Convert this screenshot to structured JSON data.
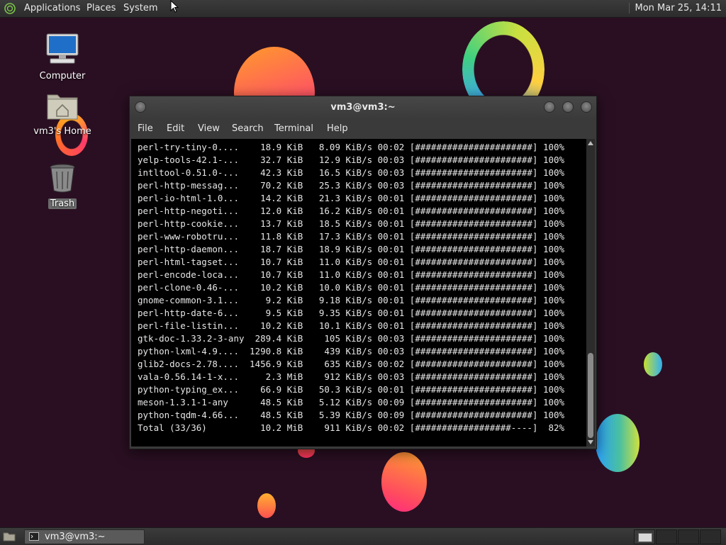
{
  "top_panel": {
    "menus": [
      "Applications",
      "Places",
      "System"
    ],
    "clock": "Mon Mar 25, 14:11"
  },
  "desktop_icons": [
    {
      "label": "Computer",
      "icon": "computer-icon"
    },
    {
      "label": "vm3's Home",
      "icon": "home-folder-icon"
    },
    {
      "label": "Trash",
      "icon": "trash-icon"
    }
  ],
  "window": {
    "title": "vm3@vm3:~",
    "menus": [
      "File",
      "Edit",
      "View",
      "Search",
      "Terminal",
      "Help"
    ]
  },
  "terminal": {
    "lines": [
      {
        "name": "perl-try-tiny-0....",
        "size": "18.9 KiB",
        "rate": "8.09 KiB/s",
        "time": "00:02",
        "bar": "[######################]",
        "pct": "100%"
      },
      {
        "name": "yelp-tools-42.1-...",
        "size": "32.7 KiB",
        "rate": "12.9 KiB/s",
        "time": "00:03",
        "bar": "[######################]",
        "pct": "100%"
      },
      {
        "name": "intltool-0.51.0-...",
        "size": "42.3 KiB",
        "rate": "16.5 KiB/s",
        "time": "00:03",
        "bar": "[######################]",
        "pct": "100%"
      },
      {
        "name": "perl-http-messag...",
        "size": "70.2 KiB",
        "rate": "25.3 KiB/s",
        "time": "00:03",
        "bar": "[######################]",
        "pct": "100%"
      },
      {
        "name": "perl-io-html-1.0...",
        "size": "14.2 KiB",
        "rate": "21.3 KiB/s",
        "time": "00:01",
        "bar": "[######################]",
        "pct": "100%"
      },
      {
        "name": "perl-http-negoti...",
        "size": "12.0 KiB",
        "rate": "16.2 KiB/s",
        "time": "00:01",
        "bar": "[######################]",
        "pct": "100%"
      },
      {
        "name": "perl-http-cookie...",
        "size": "13.7 KiB",
        "rate": "18.5 KiB/s",
        "time": "00:01",
        "bar": "[######################]",
        "pct": "100%"
      },
      {
        "name": "perl-www-robotru...",
        "size": "11.8 KiB",
        "rate": "17.3 KiB/s",
        "time": "00:01",
        "bar": "[######################]",
        "pct": "100%"
      },
      {
        "name": "perl-http-daemon...",
        "size": "18.7 KiB",
        "rate": "18.9 KiB/s",
        "time": "00:01",
        "bar": "[######################]",
        "pct": "100%"
      },
      {
        "name": "perl-html-tagset...",
        "size": "10.7 KiB",
        "rate": "11.0 KiB/s",
        "time": "00:01",
        "bar": "[######################]",
        "pct": "100%"
      },
      {
        "name": "perl-encode-loca...",
        "size": "10.7 KiB",
        "rate": "11.0 KiB/s",
        "time": "00:01",
        "bar": "[######################]",
        "pct": "100%"
      },
      {
        "name": "perl-clone-0.46-...",
        "size": "10.2 KiB",
        "rate": "10.0 KiB/s",
        "time": "00:01",
        "bar": "[######################]",
        "pct": "100%"
      },
      {
        "name": "gnome-common-3.1...",
        "size": "9.2 KiB",
        "rate": "9.18 KiB/s",
        "time": "00:01",
        "bar": "[######################]",
        "pct": "100%"
      },
      {
        "name": "perl-http-date-6...",
        "size": "9.5 KiB",
        "rate": "9.35 KiB/s",
        "time": "00:01",
        "bar": "[######################]",
        "pct": "100%"
      },
      {
        "name": "perl-file-listin...",
        "size": "10.2 KiB",
        "rate": "10.1 KiB/s",
        "time": "00:01",
        "bar": "[######################]",
        "pct": "100%"
      },
      {
        "name": "gtk-doc-1.33.2-3-any",
        "size": "289.4 KiB",
        "rate": "105 KiB/s",
        "time": "00:03",
        "bar": "[######################]",
        "pct": "100%"
      },
      {
        "name": "python-lxml-4.9....",
        "size": "1290.8 KiB",
        "rate": "439 KiB/s",
        "time": "00:03",
        "bar": "[######################]",
        "pct": "100%"
      },
      {
        "name": "glib2-docs-2.78....",
        "size": "1456.9 KiB",
        "rate": "635 KiB/s",
        "time": "00:02",
        "bar": "[######################]",
        "pct": "100%"
      },
      {
        "name": "vala-0.56.14-1-x...",
        "size": "2.3 MiB",
        "rate": "912 KiB/s",
        "time": "00:03",
        "bar": "[######################]",
        "pct": "100%"
      },
      {
        "name": "python-typing_ex...",
        "size": "66.9 KiB",
        "rate": "50.3 KiB/s",
        "time": "00:01",
        "bar": "[######################]",
        "pct": "100%"
      },
      {
        "name": "meson-1.3.1-1-any",
        "size": "48.5 KiB",
        "rate": "5.12 KiB/s",
        "time": "00:09",
        "bar": "[######################]",
        "pct": "100%"
      },
      {
        "name": "python-tqdm-4.66...",
        "size": "48.5 KiB",
        "rate": "5.39 KiB/s",
        "time": "00:09",
        "bar": "[######################]",
        "pct": "100%"
      },
      {
        "name": "Total (33/36)",
        "size": "10.2 MiB",
        "rate": "911 KiB/s",
        "time": "00:02",
        "bar": "[##################----]",
        "pct": "82%"
      }
    ]
  },
  "taskbar": {
    "task_label": "vm3@vm3:~"
  }
}
